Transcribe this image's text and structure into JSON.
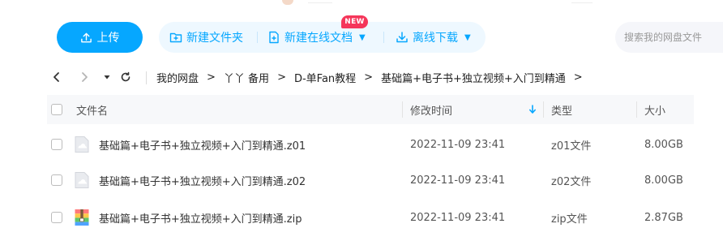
{
  "toolbar": {
    "upload_label": "上传",
    "new_folder_label": "新建文件夹",
    "new_online_doc_label": "新建在线文档",
    "new_badge": "NEW",
    "offline_download_label": "离线下载",
    "search_placeholder": "搜索我的网盘文件"
  },
  "breadcrumb": [
    "我的网盘",
    "丫丫 备用",
    "D-单Fan教程",
    "基础篇+电子书+独立视频+入门到精通"
  ],
  "breadcrumb_separator": ">",
  "table": {
    "columns": {
      "name": "文件名",
      "modified": "修改时间",
      "type": "类型",
      "size": "大小"
    },
    "rows": [
      {
        "name": "基础篇+电子书+独立视频+入门到精通.z01",
        "modified": "2022-11-09 23:41",
        "type": "z01文件",
        "size": "8.00GB",
        "icon": "generic-file-icon"
      },
      {
        "name": "基础篇+电子书+独立视频+入门到精通.z02",
        "modified": "2022-11-09 23:41",
        "type": "z02文件",
        "size": "8.00GB",
        "icon": "generic-file-icon"
      },
      {
        "name": "基础篇+电子书+独立视频+入门到精通.zip",
        "modified": "2022-11-09 23:41",
        "type": "zip文件",
        "size": "2.87GB",
        "icon": "zip-archive-icon"
      }
    ]
  },
  "colors": {
    "accent": "#06a7ff",
    "pill_bg": "#eef8ff",
    "badge": "#f5365a",
    "header_bg": "#f7f8fa"
  }
}
